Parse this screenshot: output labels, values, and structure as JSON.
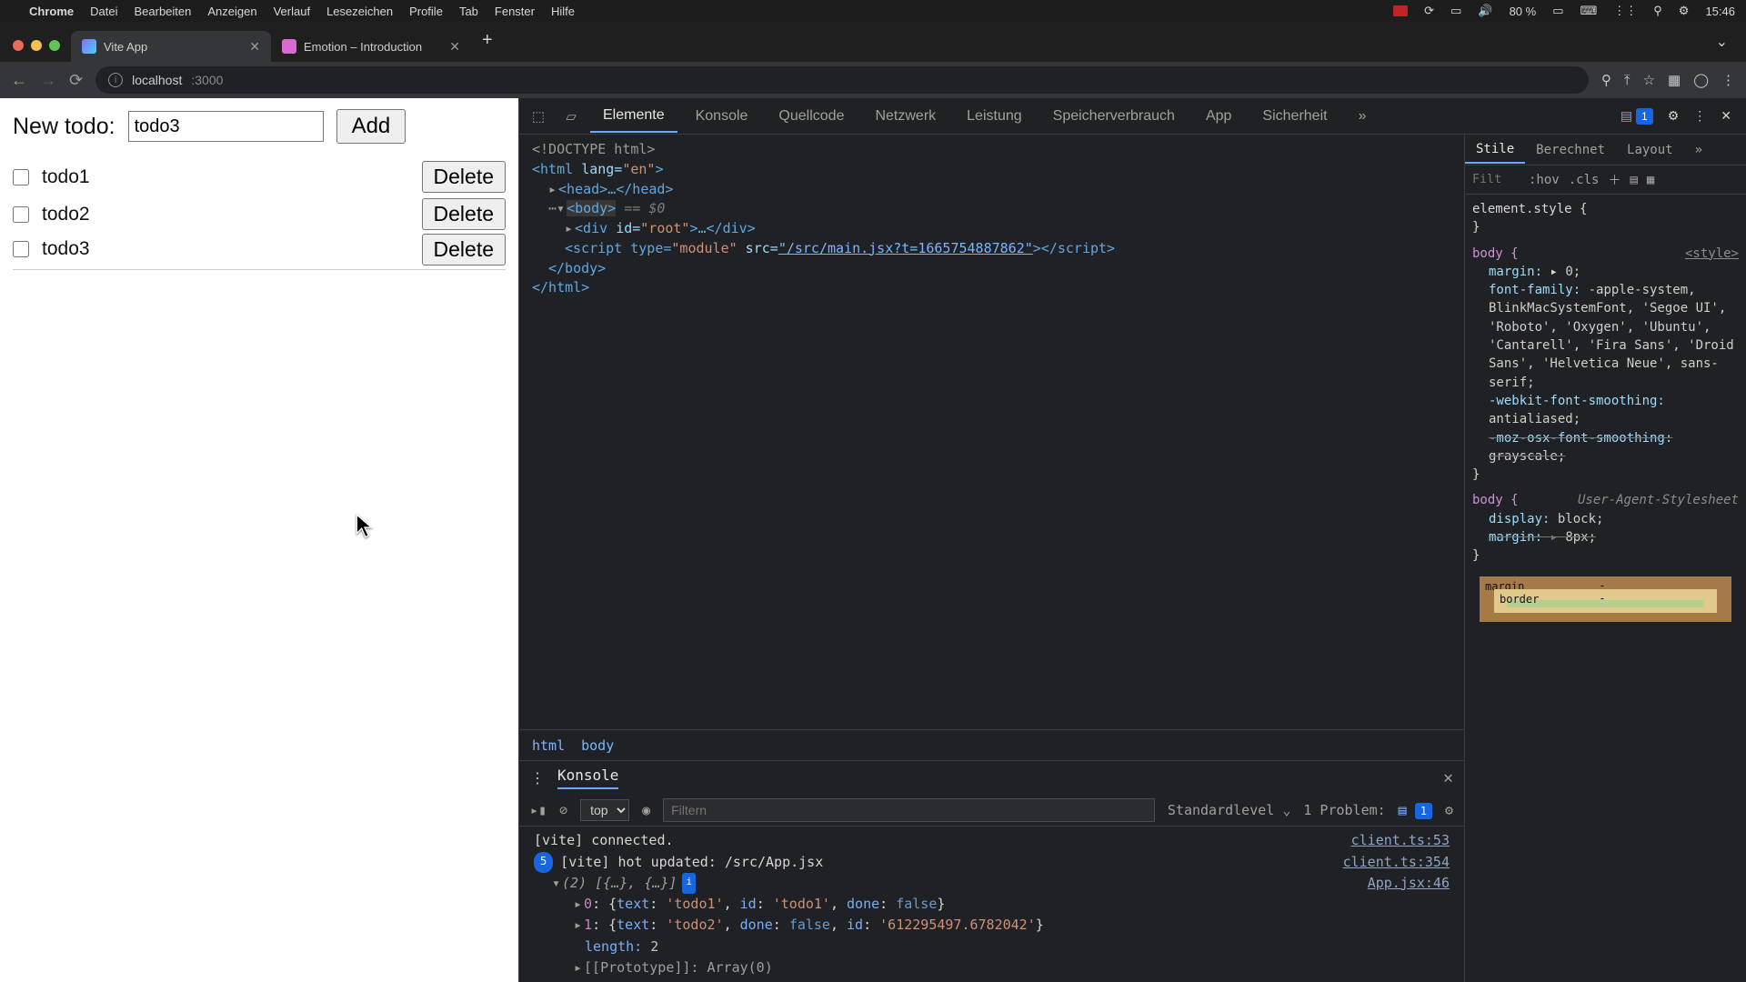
{
  "menubar": {
    "app": "Chrome",
    "items": [
      "Datei",
      "Bearbeiten",
      "Anzeigen",
      "Verlauf",
      "Lesezeichen",
      "Profile",
      "Tab",
      "Fenster",
      "Hilfe"
    ],
    "battery": "80 %",
    "clock": "15:46"
  },
  "tabs": [
    {
      "title": "Vite App",
      "active": true
    },
    {
      "title": "Emotion – Introduction",
      "active": false
    }
  ],
  "addressbar": {
    "host": "localhost",
    "port": ":3000"
  },
  "app": {
    "new_label": "New todo:",
    "input_value": "todo3",
    "add_label": "Add",
    "delete_label": "Delete",
    "todos": [
      {
        "text": "todo1",
        "done": false
      },
      {
        "text": "todo2",
        "done": false
      },
      {
        "text": "todo3",
        "done": false
      }
    ]
  },
  "devtools": {
    "tabs": [
      "Elemente",
      "Konsole",
      "Quellcode",
      "Netzwerk",
      "Leistung",
      "Speicherverbrauch",
      "App",
      "Sicherheit"
    ],
    "active_tab": "Elemente",
    "issue_count": "1",
    "dom": {
      "line1": "<!DOCTYPE html>",
      "line2_open": "<html ",
      "line2_attr": "lang=",
      "line2_val": "\"en\"",
      "line2_close": ">",
      "head": "<head>…</head>",
      "body_open": "<body>",
      "eq0": " == $0",
      "root": "<div id=\"root\">…</div>",
      "script_t": "<script type=",
      "script_v1": "\"module\"",
      "script_s": " src=",
      "script_link": "\"/src/main.jsx?t=1665754887862\"",
      "script_end": "></script>",
      "body_close": "</body>",
      "html_close": "</html>"
    },
    "breadcrumb": [
      "html",
      "body"
    ],
    "styles": {
      "tabs": [
        "Stile",
        "Berechnet",
        "Layout"
      ],
      "active": "Stile",
      "filter_ph": "Filt",
      "hov": ":hov",
      "cls": ".cls",
      "element_style": "element.style {",
      "rule_body_sel": "body {",
      "rule_body_src": "<style>",
      "rule_body_props": [
        {
          "p": "margin:",
          "v": "0;",
          "strike": false,
          "tri": true
        },
        {
          "p": "font-family:",
          "v": "-apple-system, BlinkMacSystemFont, 'Segoe UI', 'Roboto', 'Oxygen', 'Ubuntu', 'Cantarell', 'Fira Sans', 'Droid Sans', 'Helvetica Neue', sans-serif;",
          "strike": false
        },
        {
          "p": "-webkit-font-smoothing:",
          "v": "antialiased;",
          "strike": false
        },
        {
          "p": "-moz-osx-font-smoothing:",
          "v": "grayscale;",
          "strike": true
        }
      ],
      "ua_sel": "body {",
      "ua_src": "User-Agent-Stylesheet",
      "ua_props": [
        {
          "p": "display:",
          "v": "block;",
          "strike": false
        },
        {
          "p": "margin:",
          "v": "8px;",
          "strike": true,
          "tri": true
        }
      ],
      "box": {
        "margin": "margin",
        "border": "border",
        "dash": "-"
      }
    },
    "drawer": {
      "title": "Konsole",
      "context": "top",
      "filter_ph": "Filtern",
      "level": "Standardlevel",
      "problems_label": "1 Problem:",
      "problems_count": "1",
      "lines": [
        {
          "left": "[vite] connected.",
          "right": "client.ts:53",
          "count": null
        },
        {
          "left": "[vite] hot updated: /src/App.jsx",
          "right": "client.ts:354",
          "count": "5"
        },
        {
          "left": "(2) [{…}, {…}]",
          "right": "App.jsx:46",
          "count": null,
          "info": true
        }
      ],
      "expanded": {
        "line0": "0: {text: 'todo1', id: 'todo1', done: false}",
        "line1_pre": "1: {text: ",
        "line1_s1": "'todo2'",
        "line1_mid": ", done: ",
        "line1_b": "false",
        "line1_mid2": ", id: ",
        "line1_s2": "'612295497.6782042'",
        "line1_end": "}",
        "len_k": "length: ",
        "len_v": "2",
        "proto": "[[Prototype]]: Array(0)"
      }
    }
  }
}
